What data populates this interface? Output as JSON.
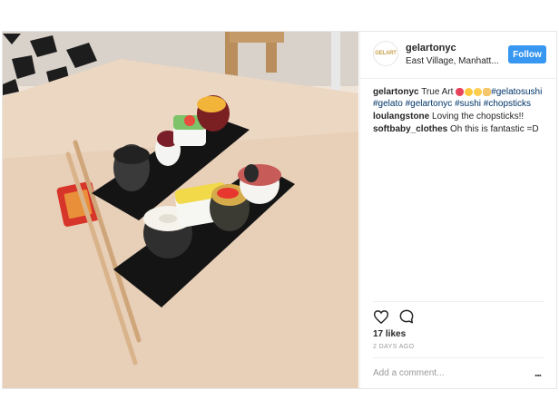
{
  "post": {
    "author": "gelartonyc",
    "avatar_text": "GELART",
    "location": "East Village, Manhatt...",
    "follow_label": "Follow",
    "caption": {
      "username": "gelartonyc",
      "text": "True Art",
      "hashtags": [
        "#gelatosushi",
        "#gelato",
        "#gelartonyc",
        "#sushi",
        "#chopsticks"
      ]
    },
    "comments": [
      {
        "username": "loulangstone",
        "text": "Loving the chopsticks!!"
      },
      {
        "username": "softbaby_clothes",
        "text": "Oh this is fantastic =D"
      }
    ],
    "likes": "17 likes",
    "timestamp": "2 DAYS AGO",
    "comment_placeholder": "Add a comment...",
    "more_label": "..."
  },
  "colors": {
    "follow_bg": "#3897f0",
    "hashtag": "#003569",
    "muted": "#999999"
  },
  "icons": [
    "heart-icon",
    "comment-icon",
    "more-options-icon"
  ]
}
